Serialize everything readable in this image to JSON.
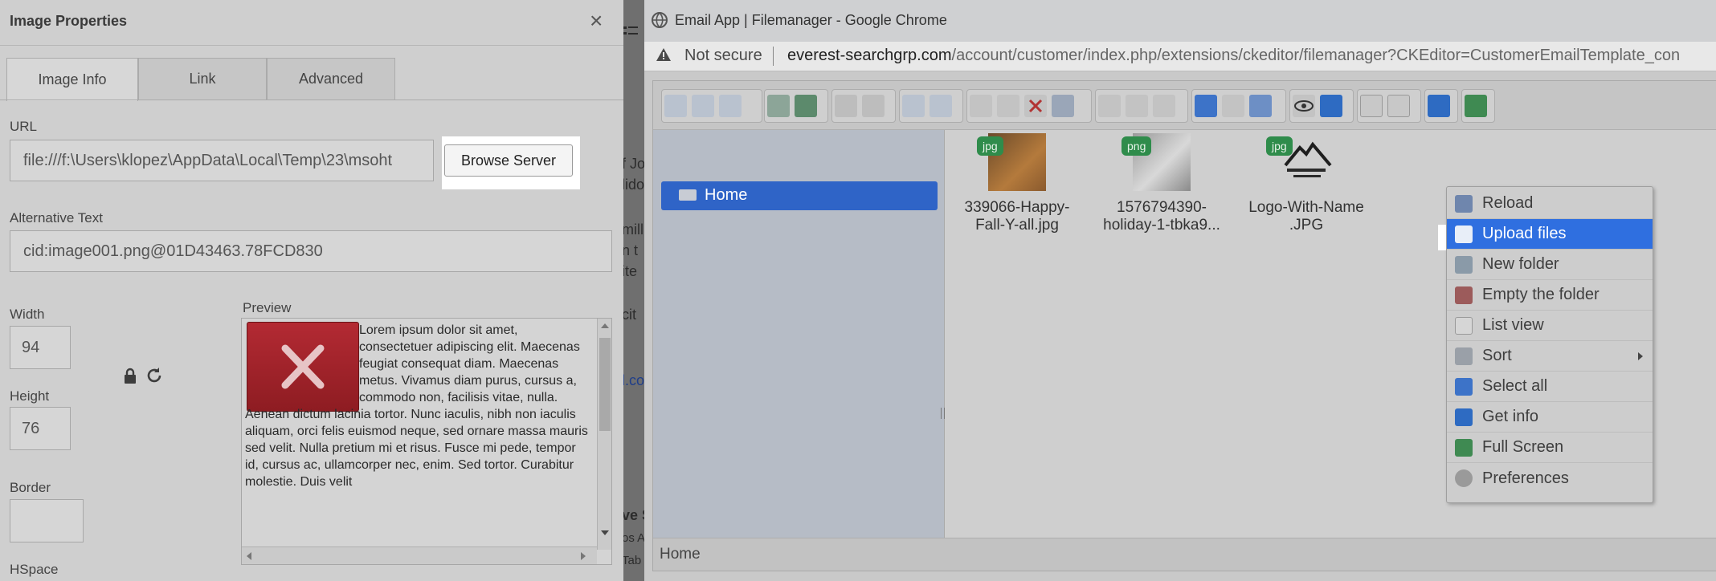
{
  "dialog": {
    "title": "Image Properties",
    "close": "×",
    "tabs": [
      "Image Info",
      "Link",
      "Advanced"
    ],
    "url_label": "URL",
    "url_value": "file:///f:\\Users\\klopez\\AppData\\Local\\Temp\\23\\msoht",
    "browse_label": "Browse Server",
    "alt_label": "Alternative Text",
    "alt_value": "cid:image001.png@01D43463.78FCD830",
    "width_label": "Width",
    "width_value": "94",
    "height_label": "Height",
    "height_value": "76",
    "border_label": "Border",
    "border_value": "",
    "hspace_label": "HSpace",
    "preview_label": "Preview",
    "preview_text": "Lorem ipsum dolor sit amet, consectetuer adipiscing elit. Maecenas feugiat consequat diam. Maecenas metus. Vivamus diam purus, cursus a, commodo non, facilisis vitae, nulla. Aenean dictum lacinia tortor. Nunc iaculis, nibh non iaculis aliquam, orci felis euismod neque, sed ornare massa mauris sed velit. Nulla pretium mi et risus. Fusce mi pede, tempor id, cursus ac, ullamcorper nec, enim. Sed tortor. Curabitur molestie. Duis velit"
  },
  "middle": {
    "fragments": [
      "f Jo",
      "lido",
      "mill",
      "n t",
      "ite",
      "cit",
      "l.co",
      "ve S",
      "os A",
      "Tab"
    ]
  },
  "chrome": {
    "window_title": "Email App | Filemanager - Google Chrome",
    "security": "Not secure",
    "url_domain": "everest-searchgrp.com",
    "url_path": "/account/customer/index.php/extensions/ckeditor/filemanager?CKEditor=CustomerEmailTemplate_con"
  },
  "filemanager": {
    "tree_root": "Home",
    "status": "Home",
    "files": [
      {
        "badge": "jpg",
        "line1": "339066-Happy-",
        "line2": "Fall-Y-all.jpg"
      },
      {
        "badge": "png",
        "line1": "1576794390-",
        "line2": "holiday-1-tbka9..."
      },
      {
        "badge": "jpg",
        "line1": "Logo-With-Name",
        "line2": ".JPG"
      }
    ],
    "context_menu": [
      "Reload",
      "Upload files",
      "New folder",
      "Empty the folder",
      "List view",
      "Sort",
      "Select all",
      "Get info",
      "Full Screen",
      "Preferences"
    ],
    "highlighted_item": "Upload files"
  },
  "colors": {
    "highlight": "#2f6fe0",
    "tree_selected": "#2f64c7",
    "badge": "#2f8c4b",
    "broken_image": "#a82630"
  }
}
